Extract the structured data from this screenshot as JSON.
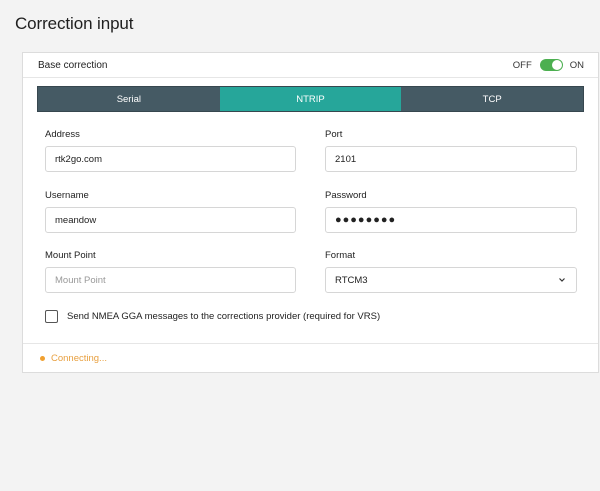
{
  "page": {
    "title": "Correction input"
  },
  "card": {
    "title": "Base correction",
    "toggle": {
      "off_label": "OFF",
      "on_label": "ON",
      "state": "on",
      "color": "#4caf50"
    }
  },
  "tabs": [
    {
      "label": "Serial",
      "active": false
    },
    {
      "label": "NTRIP",
      "active": true
    },
    {
      "label": "TCP",
      "active": false
    }
  ],
  "colors": {
    "tab_bg": "#455a64",
    "tab_active": "#26a69a",
    "status": "#f0a030"
  },
  "form": {
    "address": {
      "label": "Address",
      "value": "rtk2go.com"
    },
    "port": {
      "label": "Port",
      "value": "2101"
    },
    "username": {
      "label": "Username",
      "value": "meandow"
    },
    "password": {
      "label": "Password",
      "value": "●●●●●●●●"
    },
    "mount_point": {
      "label": "Mount Point",
      "value": "",
      "placeholder": "Mount Point"
    },
    "format": {
      "label": "Format",
      "value": "RTCM3",
      "icon": "chevron-down-icon"
    }
  },
  "gga_checkbox": {
    "label": "Send NMEA GGA messages to the corrections provider (required for VRS)",
    "checked": false
  },
  "status": {
    "text": "Connecting..."
  }
}
